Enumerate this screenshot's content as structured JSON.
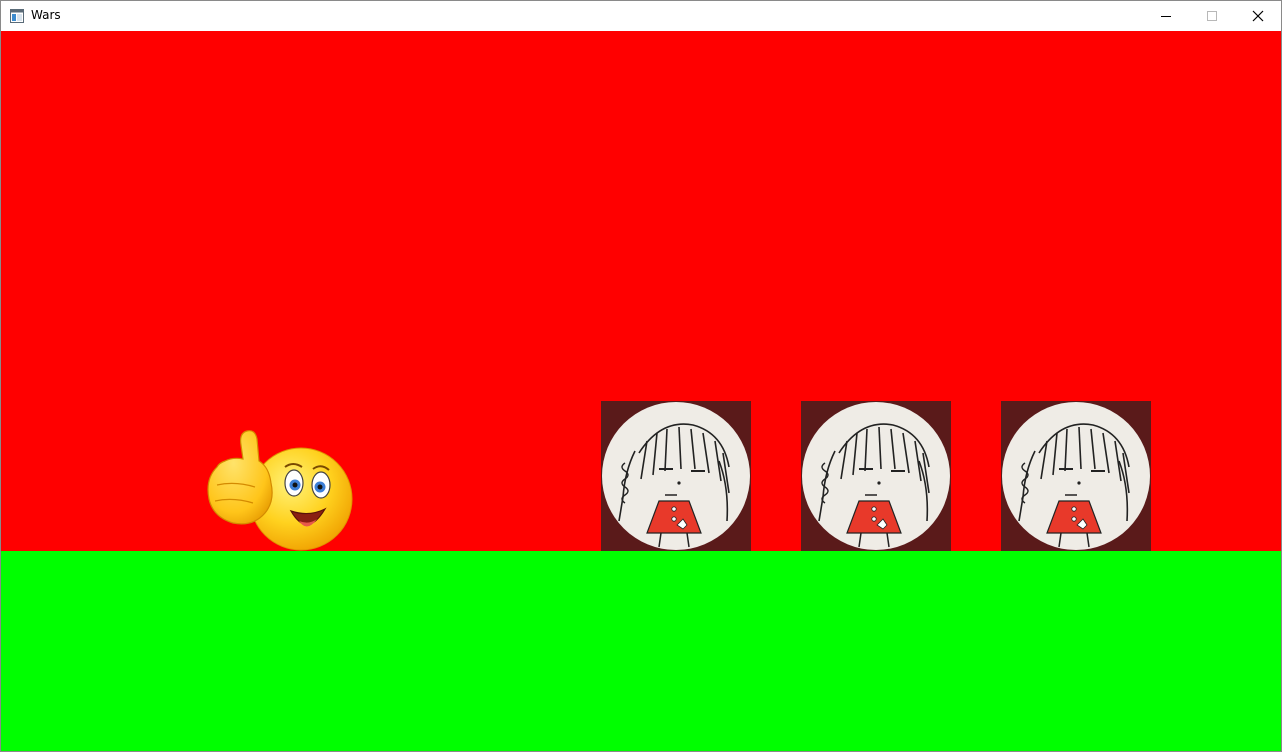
{
  "window": {
    "title": "Wars",
    "app_icon": "window-app-icon",
    "controls": [
      "minimize-icon",
      "maximize-icon",
      "close-icon"
    ]
  },
  "scene": {
    "sky_color": "#ff0000",
    "ground_color": "#00ff00",
    "player": {
      "icon": "thumbs-up-smiley-sprite"
    },
    "enemies": [
      {
        "icon": "sketch-girl-sprite"
      },
      {
        "icon": "sketch-girl-sprite"
      },
      {
        "icon": "sketch-girl-sprite"
      }
    ]
  }
}
